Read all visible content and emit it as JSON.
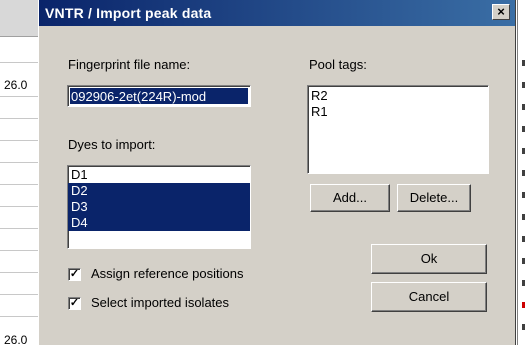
{
  "background": {
    "left_values": [
      "26.0",
      "26.0"
    ]
  },
  "dialog": {
    "title": "VNTR / Import peak data",
    "close_label": "×",
    "fingerprint_label": "Fingerprint file name:",
    "fingerprint_value": "092906-2et(224R)-mod",
    "dyes_label": "Dyes to import:",
    "dyes": [
      {
        "label": "D1",
        "selected": false
      },
      {
        "label": "D2",
        "selected": true
      },
      {
        "label": "D3",
        "selected": true
      },
      {
        "label": "D4",
        "selected": true
      }
    ],
    "pool_label": "Pool tags:",
    "pool_tags": [
      "R2",
      "R1"
    ],
    "add_label": "Add...",
    "delete_label": "Delete...",
    "ok_label": "Ok",
    "cancel_label": "Cancel",
    "assign_label": "Assign reference positions",
    "assign_checked": true,
    "select_label": "Select imported isolates",
    "select_checked": true,
    "check_glyph": "✓"
  },
  "colors": {
    "selection": "#0a246a",
    "dialog_face": "#d4d0c8",
    "title_start": "#0a246a",
    "title_end": "#3a6ea5"
  }
}
